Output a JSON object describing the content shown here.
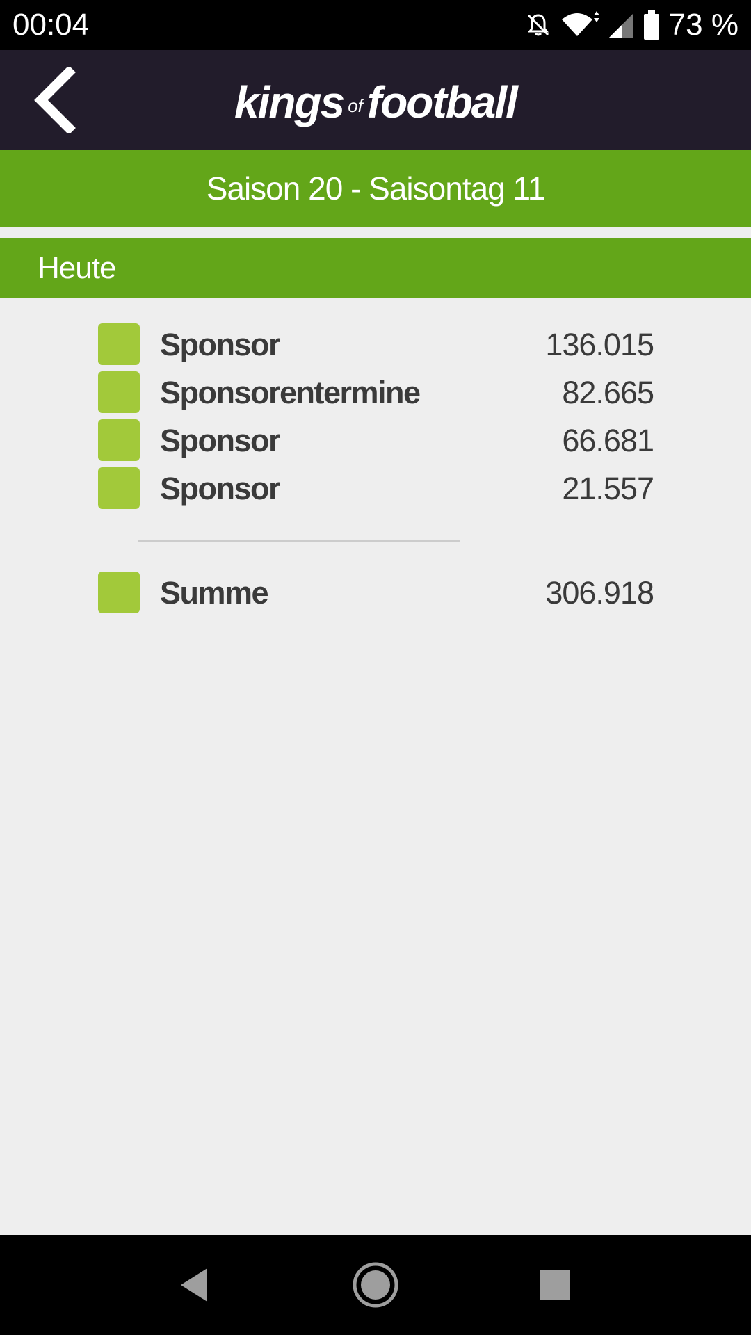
{
  "status_bar": {
    "time": "00:04",
    "battery_text": "73 %",
    "icons": [
      "notifications-off-icon",
      "wifi-icon",
      "signal-icon",
      "battery-icon"
    ]
  },
  "header": {
    "logo_kings": "kings",
    "logo_of": "of",
    "logo_football": "football",
    "back_icon": "chevron-left-icon"
  },
  "season_bar": {
    "title": "Saison 20 - Saisontag 11"
  },
  "section": {
    "title": "Heute"
  },
  "rows": [
    {
      "label": "Sponsor",
      "value": "136.015"
    },
    {
      "label": "Sponsorentermine",
      "value": "82.665"
    },
    {
      "label": "Sponsor",
      "value": "66.681"
    },
    {
      "label": "Sponsor",
      "value": "21.557"
    }
  ],
  "total": {
    "label": "Summe",
    "value": "306.918"
  },
  "colors": {
    "header_bg": "#221c2b",
    "green_bar": "#63a619",
    "row_square": "#a2c93a",
    "body_bg": "#eeeeee"
  },
  "nav_bar": {
    "icons": [
      "back-triangle-icon",
      "home-circle-icon",
      "recents-square-icon"
    ]
  }
}
